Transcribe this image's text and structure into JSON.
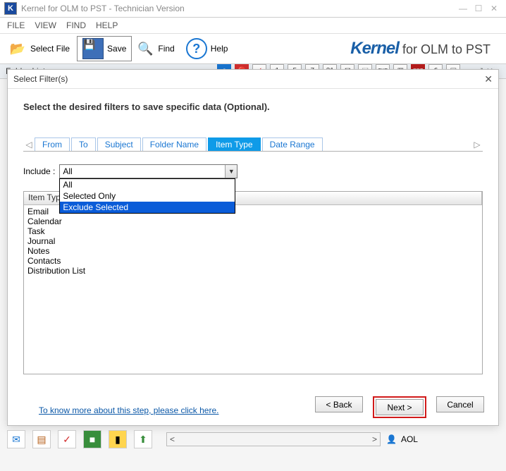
{
  "window": {
    "app_icon_letter": "K",
    "title": "Kernel for OLM to PST - Technician Version"
  },
  "menus": [
    "FILE",
    "VIEW",
    "FIND",
    "HELP"
  ],
  "toolbar": {
    "select_file": "Select File",
    "save": "Save",
    "find": "Find",
    "help": "Help"
  },
  "brand": {
    "logo": "Kernel",
    "rest": "for OLM to PST"
  },
  "folder_panel_label": "Folder List",
  "mini_icons": [
    "e",
    "⛔",
    "✓",
    "1",
    "5",
    "7",
    "31",
    "✉",
    "⬚",
    "TXT",
    "▦",
    "PDF",
    "⎙",
    "▤"
  ],
  "dialog": {
    "title": "Select Filter(s)",
    "instruction": "Select the desired filters to save specific data (Optional).",
    "tabs": [
      "From",
      "To",
      "Subject",
      "Folder Name",
      "Item Type",
      "Date Range"
    ],
    "active_tab_index": 4,
    "include_label": "Include :",
    "include_value": "All",
    "include_options": [
      "All",
      "Selected Only",
      "Exclude Selected"
    ],
    "include_highlight_index": 2,
    "table": {
      "header": "Item Type",
      "rows": [
        "Email",
        "Calendar",
        "Task",
        "Journal",
        "Notes",
        "Contacts",
        "Distribution List"
      ]
    },
    "help_link": "To know more about this step, please click here.",
    "buttons": {
      "back": "< Back",
      "next": "Next >",
      "cancel": "Cancel"
    }
  },
  "bottom": {
    "aol": "AOL"
  }
}
